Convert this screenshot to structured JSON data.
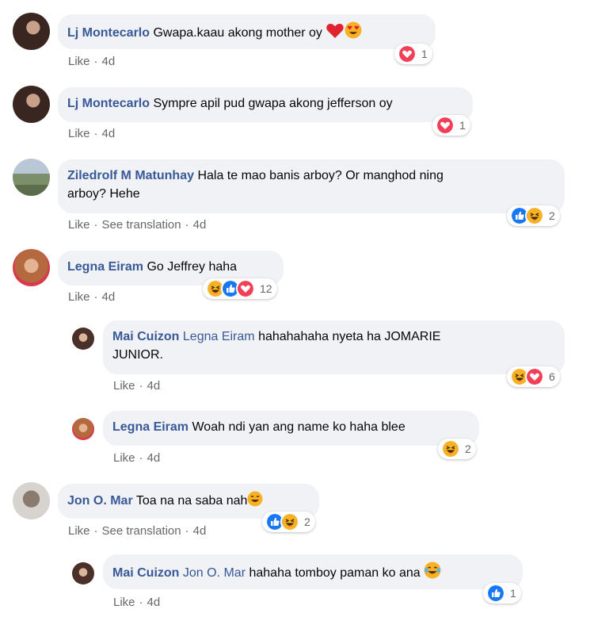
{
  "comments": [
    {
      "author": "Lj Montecarlo",
      "text": "Gwapa.kaau akong mother oy",
      "actions": [
        "Like",
        "4d"
      ],
      "reaction_count": "1"
    },
    {
      "author": "Lj Montecarlo",
      "text": "Sympre apil pud gwapa akong jefferson oy",
      "actions": [
        "Like",
        "4d"
      ],
      "reaction_count": "1"
    },
    {
      "author": "Ziledrolf M Matunhay",
      "text": "Hala te mao banis arboy? Or manghod ning",
      "text2": "arboy? Hehe",
      "actions": [
        "Like",
        "See translation",
        "4d"
      ],
      "reaction_count": "2"
    },
    {
      "author": "Legna Eiram",
      "text": "Go Jeffrey haha",
      "actions": [
        "Like",
        "4d"
      ],
      "reaction_count": "12"
    },
    {
      "author": "Mai Cuizon",
      "mention": "Legna Eiram",
      "text": "hahahahaha nyeta ha JOMARIE",
      "text2": "JUNIOR.",
      "actions": [
        "Like",
        "4d"
      ],
      "reaction_count": "6"
    },
    {
      "author": "Legna Eiram",
      "text": "Woah ndi yan ang name ko haha blee",
      "actions": [
        "Like",
        "4d"
      ],
      "reaction_count": "2"
    },
    {
      "author": "Jon O. Mar",
      "text": "Toa na na saba nah",
      "actions": [
        "Like",
        "See translation",
        "4d"
      ],
      "reaction_count": "2"
    },
    {
      "author": "Mai Cuizon",
      "mention": "Jon O. Mar",
      "text": "hahaha tomboy paman ko ana",
      "actions": [
        "Like",
        "4d"
      ],
      "reaction_count": "1"
    }
  ],
  "colors": {
    "author": "#385898",
    "bubble": "#f0f2f5",
    "meta": "#65676b",
    "heart": "#f33e58",
    "like": "#1877f2",
    "haha": "#f7b125"
  },
  "icons": [
    "heart-icon",
    "heart-eyes-emoji-icon",
    "like-icon",
    "haha-icon",
    "avatar-icon"
  ]
}
